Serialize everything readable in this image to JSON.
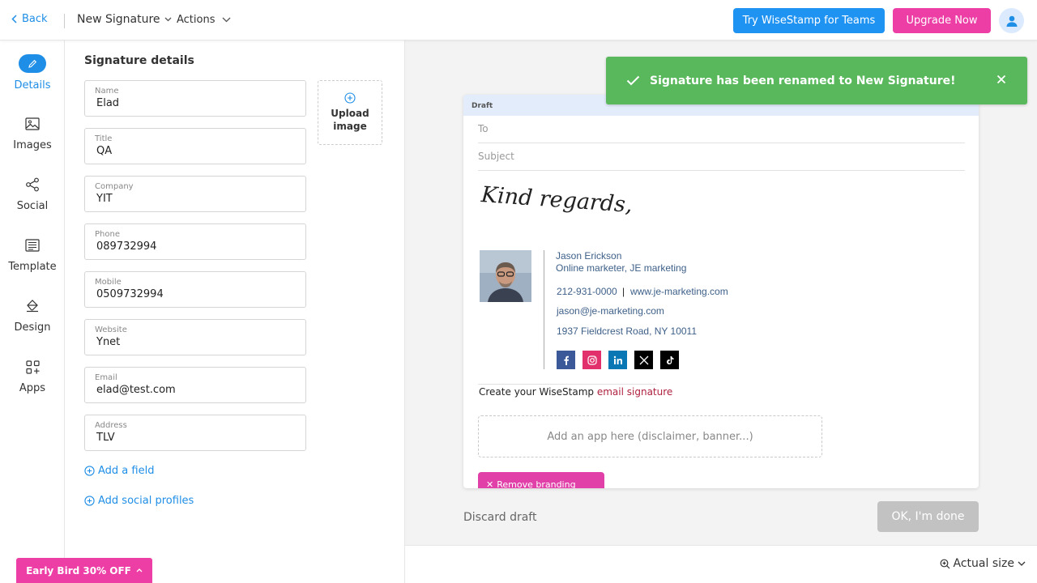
{
  "topbar": {
    "back_label": "Back",
    "signature_name": "New Signature",
    "actions_label": "Actions",
    "teams_button": "Try WiseStamp for Teams",
    "upgrade_button": "Upgrade Now"
  },
  "colors": {
    "accent_blue": "#1f93f2",
    "brand_pink": "#ed3ea6",
    "success_green": "#59b85c"
  },
  "sidenav": [
    {
      "label": "Details",
      "icon": "pencil-icon",
      "active": true
    },
    {
      "label": "Images",
      "icon": "image-icon"
    },
    {
      "label": "Social",
      "icon": "share-icon"
    },
    {
      "label": "Template",
      "icon": "template-icon"
    },
    {
      "label": "Design",
      "icon": "paint-bucket-icon"
    },
    {
      "label": "Apps",
      "icon": "apps-grid-icon"
    }
  ],
  "form": {
    "heading": "Signature details",
    "fields": [
      {
        "label": "Name",
        "value": "Elad"
      },
      {
        "label": "Title",
        "value": "QA"
      },
      {
        "label": "Company",
        "value": "YIT"
      },
      {
        "label": "Phone",
        "value": "089732994"
      },
      {
        "label": "Mobile",
        "value": "0509732994"
      },
      {
        "label": "Website",
        "value": "Ynet"
      },
      {
        "label": "Email",
        "value": "elad@test.com"
      },
      {
        "label": "Address",
        "value": "TLV"
      }
    ],
    "upload_label": "Upload image",
    "add_field": "Add a field",
    "add_social": "Add social profiles"
  },
  "promo": {
    "early_bird": "Early Bird 30% OFF"
  },
  "toast": {
    "message": "Signature has been renamed to New Signature!"
  },
  "preview": {
    "draft_label": "Draft",
    "to_label": "To",
    "subject_label": "Subject",
    "closing": "Kind regards,",
    "sig_name": "Jason Erickson",
    "sig_title": "Online marketer, JE marketing",
    "sig_phone": "212-931-0000",
    "sig_sep": "|",
    "sig_website": "www.je-marketing.com",
    "sig_email": "jason@je-marketing.com",
    "sig_address": "1937 Fieldcrest Road, NY 10011",
    "social_icons": [
      "facebook-icon",
      "instagram-icon",
      "linkedin-icon",
      "x-icon",
      "tiktok-icon"
    ],
    "create_prefix": "Create your WiseStamp ",
    "create_link": "email signature",
    "add_app": "Add an app here (disclaimer, banner...)",
    "remove_branding": "Remove branding"
  },
  "footer": {
    "discard": "Discard draft",
    "ok_done": "OK, I'm done",
    "zoom_label": "Actual size"
  }
}
